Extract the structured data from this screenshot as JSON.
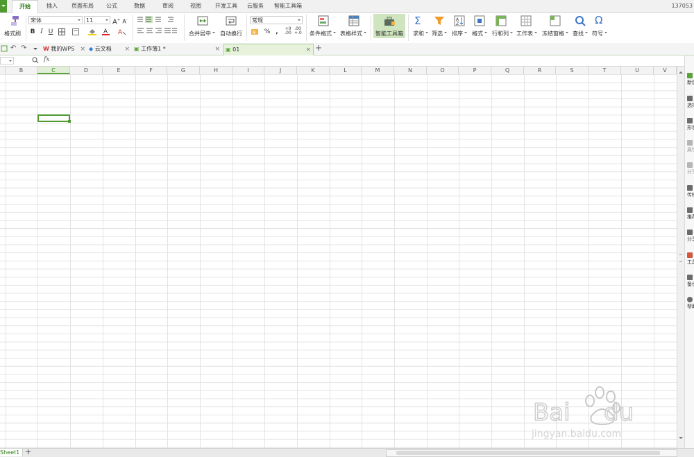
{
  "ribbon_tabs": [
    "开始",
    "插入",
    "页面布局",
    "公式",
    "数据",
    "审阅",
    "视图",
    "开发工具",
    "云服务",
    "智能工具箱"
  ],
  "active_tab": "开始",
  "user_id": "137053",
  "toolbar": {
    "format_painter": "格式刷",
    "font_name": "宋体",
    "font_size": "11",
    "bold": "B",
    "italic": "I",
    "underline": "U",
    "merge_center": "合并居中",
    "auto_wrap": "自动换行",
    "number_format": "常规",
    "percent": "%",
    "comma": ",",
    "cond_format": "条件格式",
    "table_style": "表格样式",
    "smart_toolbox": "智能工具箱",
    "sum": "求和",
    "filter": "筛选",
    "sort": "排序",
    "format": "格式",
    "row_col": "行和列",
    "worksheet": "工作表",
    "freeze": "冻结窗格",
    "find": "查找",
    "symbol": "符号"
  },
  "doc_tabs": [
    {
      "label": "我的WPS"
    },
    {
      "label": "云文档"
    },
    {
      "label": "工作簿1 *"
    },
    {
      "label": "01"
    }
  ],
  "formula_bar": {
    "fx": "fx"
  },
  "columns": [
    "B",
    "C",
    "D",
    "E",
    "F",
    "G",
    "H",
    "I",
    "J",
    "K",
    "L",
    "M",
    "N",
    "O",
    "P",
    "Q",
    "R",
    "S",
    "T",
    "U",
    "V"
  ],
  "selected_column": "C",
  "right_pane": [
    "新建",
    "选择",
    "形状",
    "属性",
    "分享",
    "传输",
    "推荐",
    "分享",
    "工具",
    "备份",
    "帮助"
  ],
  "sheet_tab": "Sheet1",
  "colors": {
    "accent": "#4e9a2e",
    "header_bg": "#f3f3f3",
    "grid": "#e3e3e3"
  }
}
